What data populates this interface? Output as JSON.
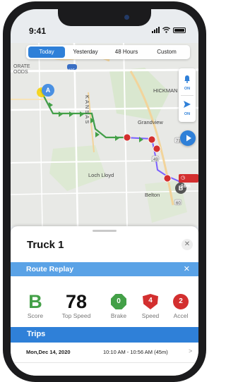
{
  "status_bar": {
    "time": "9:41"
  },
  "tabs": [
    "Today",
    "Yesterday",
    "48 Hours",
    "Custom"
  ],
  "map": {
    "labels": {
      "kansas": "KANSAS",
      "grandview": "Grandview",
      "hickman_mills": "HICKMAN MI",
      "loch_lloyd": "Loch Lloyd",
      "belton": "Belton",
      "corner": "ORATE\nOODS"
    },
    "highway_shields": [
      "435",
      "49",
      "60",
      "71",
      "150"
    ],
    "start_marker": "A",
    "end_marker": "B",
    "stop_duration": "16m",
    "controls": {
      "alerts": "ON",
      "directions": "ON"
    },
    "route_color": "#43a047",
    "replay_route_color": "#7b61ff"
  },
  "sheet": {
    "title": "Truck 1",
    "close_icon": "close-icon",
    "replay_label": "Route Replay",
    "stats": {
      "score": {
        "value": "B",
        "label": "Score"
      },
      "top_speed": {
        "value": "78",
        "label": "Top Speed"
      },
      "brake": {
        "count": "0",
        "label": "Brake"
      },
      "speed": {
        "count": "4",
        "label": "Speed"
      },
      "accel": {
        "count": "2",
        "label": "Accel"
      }
    },
    "trips_label": "Trips",
    "trips": [
      {
        "date": "Mon,Dec 14, 2020",
        "time": "10:10 AM - 10:56 AM (45m)"
      }
    ]
  },
  "colors": {
    "accent": "#2f80d8",
    "replay_bar": "#5aa2e6",
    "good": "#43a047",
    "bad": "#d32f2f"
  }
}
